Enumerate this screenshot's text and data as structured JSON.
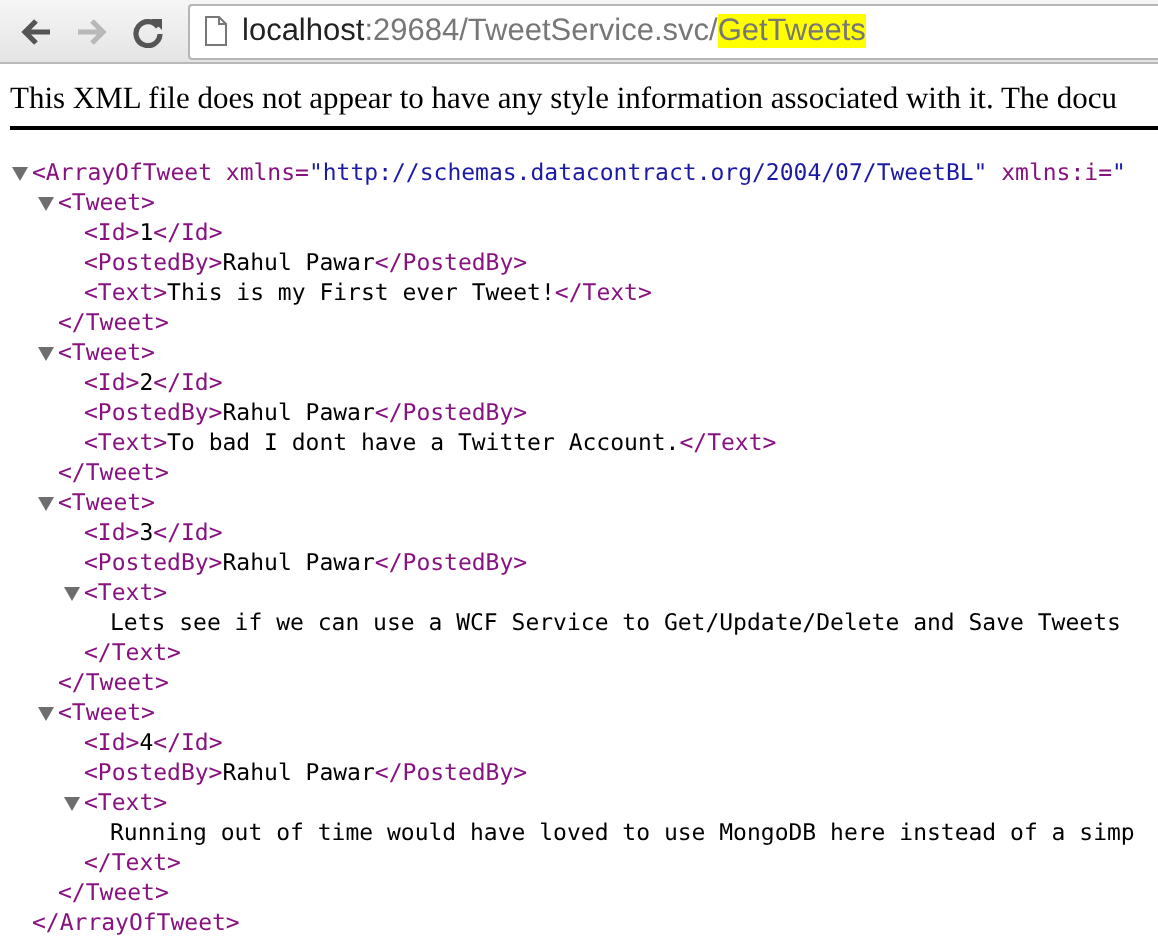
{
  "toolbar": {
    "buttons": [
      {
        "kind": "back",
        "disabled": false
      },
      {
        "kind": "forward",
        "disabled": true
      },
      {
        "kind": "reload",
        "disabled": false
      }
    ],
    "address": {
      "host": "localhost",
      "path": ":29684/TweetService.svc/",
      "highlight": "GetTweets"
    }
  },
  "notice": "This XML file does not appear to have any style information associated with it. The docu",
  "xml": {
    "root": {
      "kind": "element",
      "open": "<ArrayOfTweet",
      "attributes": [
        {
          "name": "xmlns=",
          "value": "\"http://schemas.datacontract.org/2004/07/TweetBL\""
        },
        {
          "name": "xmlns:i=",
          "value": "\""
        }
      ],
      "expanded": true,
      "close": "</ArrayOfTweet>",
      "children": [
        {
          "kind": "element",
          "open": "<Tweet>",
          "expanded": true,
          "close": "</Tweet>",
          "children": [
            {
              "kind": "leaf",
              "open": "<Id>",
              "text": "1",
              "close": "</Id>"
            },
            {
              "kind": "leaf",
              "open": "<PostedBy>",
              "text": "Rahul Pawar",
              "close": "</PostedBy>"
            },
            {
              "kind": "leaf",
              "open": "<Text>",
              "text": "This is my First ever Tweet!",
              "close": "</Text>"
            }
          ]
        },
        {
          "kind": "element",
          "open": "<Tweet>",
          "expanded": true,
          "close": "</Tweet>",
          "children": [
            {
              "kind": "leaf",
              "open": "<Id>",
              "text": "2",
              "close": "</Id>"
            },
            {
              "kind": "leaf",
              "open": "<PostedBy>",
              "text": "Rahul Pawar",
              "close": "</PostedBy>"
            },
            {
              "kind": "leaf",
              "open": "<Text>",
              "text": "To bad I dont have a Twitter Account.",
              "close": "</Text>"
            }
          ]
        },
        {
          "kind": "element",
          "open": "<Tweet>",
          "expanded": true,
          "close": "</Tweet>",
          "children": [
            {
              "kind": "leaf",
              "open": "<Id>",
              "text": "3",
              "close": "</Id>"
            },
            {
              "kind": "leaf",
              "open": "<PostedBy>",
              "text": "Rahul Pawar",
              "close": "</PostedBy>"
            },
            {
              "kind": "element",
              "open": "<Text>",
              "expanded": true,
              "close": "</Text>",
              "children": [
                {
                  "kind": "text",
                  "text": "Lets see if we can use a WCF Service to Get/Update/Delete and Save Tweets"
                }
              ]
            }
          ]
        },
        {
          "kind": "element",
          "open": "<Tweet>",
          "expanded": true,
          "close": "</Tweet>",
          "children": [
            {
              "kind": "leaf",
              "open": "<Id>",
              "text": "4",
              "close": "</Id>"
            },
            {
              "kind": "leaf",
              "open": "<PostedBy>",
              "text": "Rahul Pawar",
              "close": "</PostedBy>"
            },
            {
              "kind": "element",
              "open": "<Text>",
              "expanded": true,
              "close": "</Text>",
              "children": [
                {
                  "kind": "text",
                  "text": "Running out of time would have loved to use MongoDB here instead of a simp"
                }
              ]
            }
          ]
        }
      ]
    }
  }
}
